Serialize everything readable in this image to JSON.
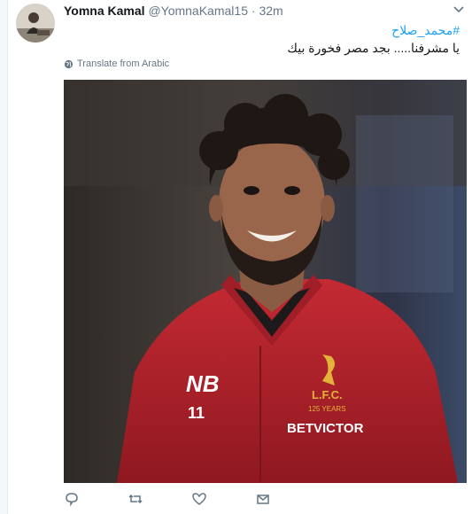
{
  "tweet": {
    "author_name": "Yomna Kamal",
    "author_handle": "@YomnaKamal15",
    "separator": "·",
    "time": "32m",
    "hashtag": "#محمد_صلاح",
    "text": "يا مشرفنا..... بجد مصر فخورة بيك",
    "translate_label": "Translate from Arabic"
  },
  "photo": {
    "jersey_sponsor": "BETVICTOR",
    "jersey_number": "11",
    "crest_text": "L.F.C.",
    "crest_sub": "125 YEARS"
  },
  "icons": {
    "reply": "reply-icon",
    "retweet": "retweet-icon",
    "like": "heart-icon",
    "dm": "envelope-icon",
    "translate": "globe-icon",
    "menu": "chevron-down-icon"
  },
  "colors": {
    "link": "#1da1f2",
    "muted": "#657786",
    "text": "#14171a",
    "jersey": "#b8222b"
  }
}
